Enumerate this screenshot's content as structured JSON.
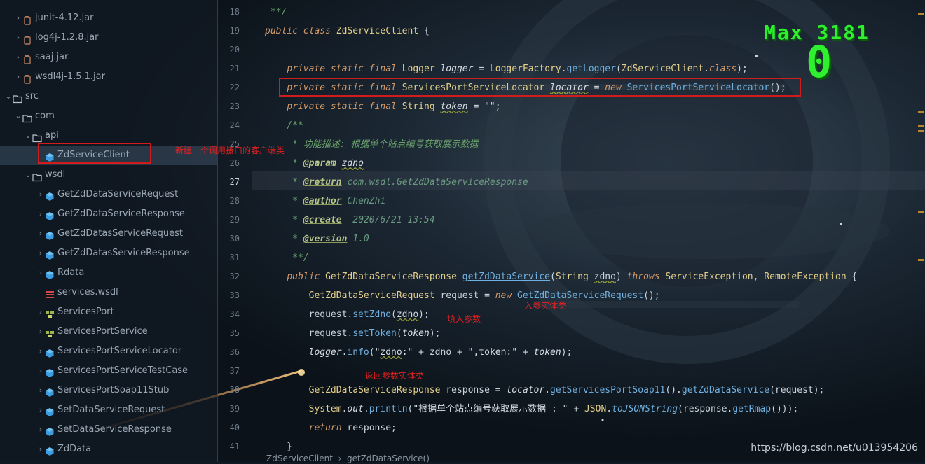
{
  "tree": {
    "items": [
      {
        "label": "junit-4.12.jar",
        "indent": 1,
        "expand": "right",
        "icon": "jar-icon"
      },
      {
        "label": "log4j-1.2.8.jar",
        "indent": 1,
        "expand": "right",
        "icon": "jar-icon"
      },
      {
        "label": "saaj.jar",
        "indent": 1,
        "expand": "right",
        "icon": "jar-icon"
      },
      {
        "label": "wsdl4j-1.5.1.jar",
        "indent": 1,
        "expand": "right",
        "icon": "jar-icon"
      },
      {
        "label": "src",
        "indent": 0,
        "expand": "down",
        "icon": "folder-icon"
      },
      {
        "label": "com",
        "indent": 1,
        "expand": "down",
        "icon": "folder-icon"
      },
      {
        "label": "api",
        "indent": 2,
        "expand": "down",
        "icon": "folder-icon"
      },
      {
        "label": "ZdServiceClient",
        "indent": 3,
        "expand": "none",
        "icon": "class-icon",
        "selected": true
      },
      {
        "label": "wsdl",
        "indent": 2,
        "expand": "down",
        "icon": "folder-icon"
      },
      {
        "label": "GetZdDataServiceRequest",
        "indent": 3,
        "expand": "right",
        "icon": "class-icon"
      },
      {
        "label": "GetZdDataServiceResponse",
        "indent": 3,
        "expand": "right",
        "icon": "class-icon"
      },
      {
        "label": "GetZdDatasServiceRequest",
        "indent": 3,
        "expand": "right",
        "icon": "class-icon"
      },
      {
        "label": "GetZdDatasServiceResponse",
        "indent": 3,
        "expand": "right",
        "icon": "class-icon"
      },
      {
        "label": "Rdata",
        "indent": 3,
        "expand": "right",
        "icon": "class-icon"
      },
      {
        "label": "services.wsdl",
        "indent": 3,
        "expand": "none",
        "icon": "wsdl-file-icon"
      },
      {
        "label": "ServicesPort",
        "indent": 3,
        "expand": "right",
        "icon": "interface-icon"
      },
      {
        "label": "ServicesPortService",
        "indent": 3,
        "expand": "right",
        "icon": "interface-icon"
      },
      {
        "label": "ServicesPortServiceLocator",
        "indent": 3,
        "expand": "right",
        "icon": "class-icon"
      },
      {
        "label": "ServicesPortServiceTestCase",
        "indent": 3,
        "expand": "right",
        "icon": "class-icon"
      },
      {
        "label": "ServicesPortSoap11Stub",
        "indent": 3,
        "expand": "right",
        "icon": "class-icon"
      },
      {
        "label": "SetDataServiceRequest",
        "indent": 3,
        "expand": "right",
        "icon": "class-icon"
      },
      {
        "label": "SetDataServiceResponse",
        "indent": 3,
        "expand": "right",
        "icon": "class-icon"
      },
      {
        "label": "ZdData",
        "indent": 3,
        "expand": "right",
        "icon": "class-icon"
      }
    ],
    "annotation": "新建一个调用接口的客户端类"
  },
  "editor": {
    "line_numbers": [
      "18",
      "19",
      "20",
      "21",
      "22",
      "23",
      "24",
      "25",
      "26",
      "27",
      "28",
      "29",
      "30",
      "31",
      "32",
      "33",
      "34",
      "35",
      "36",
      "37",
      "38",
      "39",
      "40",
      "41"
    ],
    "current_line": "27",
    "annotations": {
      "param_entity": "入参实体类",
      "fill_params": "填入参数",
      "return_entity": "返回参数实体类"
    },
    "breadcrumb": [
      "ZdServiceClient",
      "getZdDataService()"
    ]
  },
  "score": {
    "max_label": "Max 3181",
    "current": "0"
  },
  "watermark": "https://blog.csdn.net/u013954206",
  "colors": {
    "annotation_red": "#d21b1b",
    "score_green": "#2ff02f",
    "keyword": "#d49a6a",
    "method": "#6fb0e0"
  }
}
